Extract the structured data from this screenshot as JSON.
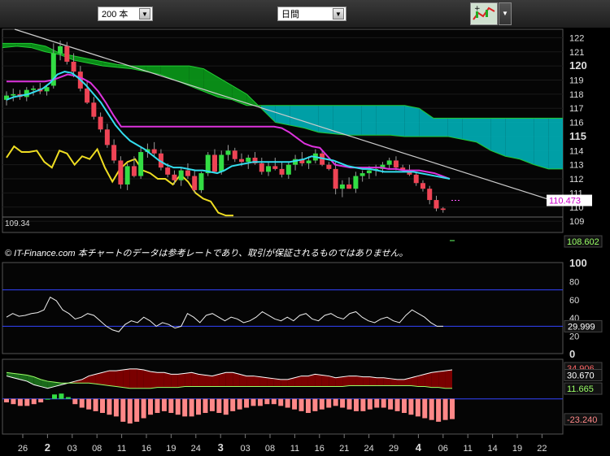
{
  "toolbar": {
    "period_select": "200 本",
    "interval_select": "日間",
    "tool_icon": "chart-tools-icon"
  },
  "colors": {
    "cloud_bull": "#0a9a1a",
    "cloud_bear": "#00b0b8",
    "up_candle": "#33dd44",
    "down_candle": "#ee4455",
    "tenkan": "#33ddee",
    "kijun": "#dd33dd",
    "chikou": "#eedd22",
    "trendline": "#cccccc"
  },
  "chart_data": [
    {
      "type": "candlestick",
      "name": "price-panel",
      "yticks": [
        "122",
        "121",
        "120",
        "119",
        "118",
        "117",
        "116",
        "115",
        "114",
        "113",
        "112",
        "111",
        "110",
        "109"
      ],
      "major_ticks": [
        "120",
        "115"
      ],
      "ylim": [
        108.2,
        122.6
      ],
      "copyright": "© IT-Finance.com  本チャートのデータは参考レートであり、取引が保証されるものではありません。",
      "price_labels": {
        "current": "110.473",
        "low": "108.602",
        "chikou_last": "109.34"
      },
      "candles": [
        [
          117.6,
          118.2,
          117.2,
          117.9
        ],
        [
          117.9,
          118.4,
          117.5,
          118.0
        ],
        [
          118.0,
          118.3,
          117.6,
          117.8
        ],
        [
          117.8,
          118.5,
          117.5,
          118.3
        ],
        [
          118.3,
          118.6,
          117.9,
          118.4
        ],
        [
          118.4,
          118.8,
          118.0,
          118.2
        ],
        [
          118.2,
          118.6,
          117.9,
          118.5
        ],
        [
          118.6,
          121.6,
          118.4,
          120.9
        ],
        [
          120.9,
          121.8,
          120.4,
          121.4
        ],
        [
          121.4,
          121.7,
          120.1,
          120.3
        ],
        [
          120.3,
          120.9,
          119.2,
          119.6
        ],
        [
          119.6,
          120.0,
          118.2,
          118.4
        ],
        [
          118.4,
          118.9,
          117.3,
          117.4
        ],
        [
          117.4,
          117.8,
          116.2,
          116.4
        ],
        [
          116.4,
          116.7,
          115.3,
          115.5
        ],
        [
          115.5,
          115.9,
          114.2,
          114.4
        ],
        [
          114.4,
          114.8,
          113.1,
          113.3
        ],
        [
          113.3,
          113.6,
          111.3,
          111.6
        ],
        [
          111.6,
          113.1,
          111.2,
          112.9
        ],
        [
          112.9,
          113.6,
          112.1,
          112.2
        ],
        [
          112.2,
          114.3,
          112.0,
          113.9
        ],
        [
          113.9,
          114.5,
          113.5,
          114.1
        ],
        [
          114.1,
          114.6,
          113.6,
          113.8
        ],
        [
          113.8,
          114.1,
          112.6,
          112.8
        ],
        [
          112.8,
          113.1,
          112.1,
          112.3
        ],
        [
          112.3,
          112.6,
          111.6,
          111.9
        ],
        [
          111.9,
          112.8,
          111.5,
          112.6
        ],
        [
          112.6,
          113.1,
          112.0,
          112.2
        ],
        [
          112.2,
          112.6,
          111.0,
          111.2
        ],
        [
          111.2,
          112.5,
          111.0,
          112.4
        ],
        [
          112.4,
          113.9,
          112.2,
          113.7
        ],
        [
          113.7,
          114.1,
          112.4,
          112.5
        ],
        [
          112.5,
          114.0,
          112.3,
          113.7
        ],
        [
          113.7,
          114.4,
          113.3,
          114.0
        ],
        [
          114.0,
          114.2,
          113.2,
          113.4
        ],
        [
          113.4,
          113.8,
          112.9,
          113.2
        ],
        [
          113.2,
          113.7,
          112.7,
          113.5
        ],
        [
          113.5,
          113.9,
          113.0,
          113.1
        ],
        [
          113.1,
          113.5,
          112.3,
          112.5
        ],
        [
          112.5,
          113.2,
          112.2,
          112.9
        ],
        [
          112.9,
          113.5,
          112.6,
          112.7
        ],
        [
          112.7,
          113.2,
          112.1,
          112.3
        ],
        [
          112.3,
          113.2,
          112.0,
          113.0
        ],
        [
          113.0,
          113.7,
          112.6,
          113.4
        ],
        [
          113.4,
          113.9,
          112.9,
          113.1
        ],
        [
          113.1,
          113.6,
          112.7,
          113.3
        ],
        [
          113.3,
          114.1,
          113.1,
          113.8
        ],
        [
          113.8,
          114.0,
          112.9,
          113.0
        ],
        [
          113.0,
          113.2,
          112.6,
          112.7
        ],
        [
          112.7,
          113.2,
          110.9,
          111.3
        ],
        [
          111.3,
          111.9,
          110.7,
          111.6
        ],
        [
          111.6,
          112.1,
          111.3,
          111.3
        ],
        [
          111.3,
          112.5,
          111.0,
          112.2
        ],
        [
          112.2,
          112.6,
          111.8,
          112.4
        ],
        [
          112.4,
          112.9,
          112.0,
          112.6
        ],
        [
          112.6,
          113.0,
          112.2,
          112.7
        ],
        [
          112.7,
          113.2,
          112.4,
          113.0
        ],
        [
          113.0,
          113.5,
          112.7,
          113.3
        ],
        [
          113.3,
          113.6,
          112.6,
          112.8
        ],
        [
          112.8,
          113.0,
          112.5,
          112.6
        ],
        [
          112.6,
          113.0,
          112.2,
          112.3
        ],
        [
          112.3,
          112.5,
          111.5,
          111.7
        ],
        [
          111.7,
          111.9,
          111.1,
          111.3
        ],
        [
          111.3,
          111.5,
          110.2,
          110.5
        ],
        [
          110.5,
          110.8,
          109.7,
          109.9
        ],
        [
          109.9,
          110.0,
          109.6,
          109.8
        ]
      ],
      "tenkan": [
        117.6,
        117.8,
        117.9,
        118.0,
        118.2,
        118.4,
        118.8,
        119.4,
        119.6,
        119.5,
        119.1,
        118.6,
        118.0,
        117.4,
        116.6,
        115.8,
        115.2,
        114.7,
        114.4,
        114.1,
        113.7,
        113.3,
        113.0,
        112.8,
        112.8,
        112.7,
        112.6,
        112.6,
        112.5,
        112.4,
        112.6,
        112.9,
        113.0,
        113.1,
        113.2,
        113.2,
        113.2,
        113.2,
        113.2,
        113.2,
        113.3,
        113.4,
        113.6,
        113.5,
        113.4,
        113.3,
        113.1,
        112.9,
        112.8,
        112.7,
        112.7,
        112.6,
        112.5,
        112.5,
        112.5,
        112.5,
        112.5,
        112.4,
        112.3,
        112.2,
        112.1,
        112.0
      ],
      "kijun": [
        118.9,
        118.9,
        118.9,
        118.9,
        118.9,
        118.9,
        119.0,
        119.2,
        119.4,
        119.3,
        119.1,
        118.8,
        118.2,
        117.4,
        116.5,
        115.7,
        115.7,
        115.7,
        115.7,
        115.7,
        115.7,
        115.7,
        115.7,
        115.7,
        115.7,
        115.7,
        115.7,
        115.7,
        115.7,
        115.7,
        115.7,
        115.7,
        115.7,
        115.7,
        115.7,
        115.7,
        115.6,
        115.3,
        114.9,
        114.5,
        114.3,
        114.2,
        113.6,
        113.0,
        112.9,
        112.8,
        112.8,
        112.8,
        112.8,
        112.8,
        112.7,
        112.7,
        112.6,
        112.6,
        112.6,
        112.5,
        112.4,
        112.2,
        112.0
      ],
      "chikou": [
        113.5,
        114.3,
        113.9,
        113.9,
        114.0,
        113.2,
        112.8,
        114.0,
        113.8,
        113.0,
        113.6,
        113.4,
        114.1,
        112.8,
        111.8,
        112.7,
        113.2,
        113.4,
        112.6,
        112.4,
        112.0,
        112.0,
        111.6,
        112.3,
        111.8,
        111.0,
        110.6,
        110.4,
        109.6,
        109.4,
        109.4
      ],
      "span_a": [
        121.3,
        121.4,
        121.3,
        121.0,
        120.8,
        120.4,
        120.2,
        120.0,
        119.9,
        119.8,
        119.6,
        119.4,
        119.0,
        118.6,
        118.2,
        117.8,
        117.6,
        117.2,
        117.2,
        117.2,
        117.2,
        117.2,
        117.2,
        117.2,
        117.2,
        117.2,
        117.2,
        117.2,
        117.2,
        117.0,
        116.3,
        116.3,
        116.3,
        116.3,
        116.3,
        116.3,
        116.3,
        116.3,
        116.3,
        116.3
      ],
      "span_b": [
        121.6,
        121.6,
        121.6,
        121.4,
        120.9,
        120.7,
        120.5,
        120.3,
        120.1,
        120.0,
        120.0,
        120.0,
        120.0,
        120.0,
        119.8,
        119.2,
        118.6,
        118.0,
        117.0,
        116.0,
        115.8,
        115.6,
        115.3,
        115.2,
        115.1,
        115.1,
        115.1,
        115.1,
        115.0,
        115.0,
        115.0,
        115.0,
        114.8,
        114.6,
        114.0,
        113.6,
        113.4,
        113.0,
        112.7,
        112.7
      ],
      "xticks": [
        "26",
        "2",
        "03",
        "08",
        "11",
        "16",
        "19",
        "24",
        "3",
        "03",
        "08",
        "11",
        "16",
        "21",
        "24",
        "29",
        "4",
        "06",
        "11",
        "14",
        "19",
        "22"
      ],
      "major_xticks": [
        "2",
        "3",
        "4"
      ]
    },
    {
      "type": "line",
      "name": "rsi-panel",
      "yticks": [
        "100",
        "80",
        "60",
        "40",
        "20",
        "0"
      ],
      "ylim": [
        0,
        100
      ],
      "levels": [
        70,
        30
      ],
      "current_label": "29.999",
      "values": [
        40,
        44,
        41,
        42,
        44,
        45,
        48,
        62,
        58,
        48,
        44,
        38,
        40,
        44,
        42,
        36,
        30,
        26,
        24,
        32,
        36,
        34,
        40,
        36,
        30,
        34,
        32,
        28,
        30,
        44,
        40,
        34,
        42,
        44,
        40,
        36,
        40,
        38,
        34,
        36,
        40,
        46,
        42,
        38,
        36,
        40,
        36,
        42,
        44,
        38,
        36,
        42,
        44,
        40,
        38,
        44,
        46,
        40,
        36,
        34,
        38,
        40,
        36,
        34,
        42,
        48,
        44,
        40,
        34,
        30,
        30
      ]
    },
    {
      "type": "area",
      "name": "macd-panel",
      "labels": [
        "34.906",
        "30.670",
        "11.665",
        "-23.240"
      ],
      "ylim": [
        -40,
        45
      ],
      "zero": 0,
      "line_a": [
        26,
        24,
        22,
        20,
        16,
        14,
        12,
        14,
        16,
        18,
        20,
        22,
        26,
        28,
        30,
        32,
        32,
        33,
        34,
        34,
        33,
        31,
        30,
        30,
        28,
        28,
        29,
        30,
        28,
        27,
        26,
        28,
        30,
        30,
        28,
        26,
        26,
        25,
        24,
        23,
        22,
        22,
        24,
        26,
        26,
        28,
        27,
        26,
        24,
        25,
        26,
        26,
        25,
        25,
        24,
        24,
        23,
        22,
        22,
        24,
        26,
        28,
        30,
        31,
        32,
        33
      ],
      "line_b": [
        30,
        29,
        28,
        27,
        25,
        22,
        20,
        19,
        18,
        18,
        18,
        18,
        18,
        17,
        16,
        15,
        14,
        13,
        12,
        12,
        12,
        12,
        13,
        13,
        13,
        13,
        14,
        14,
        14,
        14,
        14,
        14,
        14,
        14,
        14,
        14,
        14,
        14,
        14,
        14,
        14,
        14,
        14,
        14,
        14,
        14,
        14,
        14,
        14,
        14,
        15,
        15,
        15,
        15,
        15,
        15,
        15,
        15,
        15,
        15,
        14,
        14,
        13,
        13,
        12,
        12
      ],
      "hist": [
        -4,
        -6,
        -8,
        -8,
        -6,
        -4,
        0,
        5,
        6,
        2,
        -6,
        -10,
        -12,
        -14,
        -16,
        -18,
        -20,
        -26,
        -28,
        -26,
        -22,
        -18,
        -16,
        -14,
        -16,
        -18,
        -20,
        -20,
        -18,
        -16,
        -14,
        -16,
        -18,
        -14,
        -12,
        -10,
        -8,
        -8,
        -6,
        -6,
        -8,
        -10,
        -12,
        -14,
        -16,
        -14,
        -12,
        -10,
        -8,
        -10,
        -12,
        -14,
        -14,
        -12,
        -10,
        -10,
        -12,
        -14,
        -16,
        -18,
        -20,
        -22,
        -24,
        -26,
        -24,
        -23
      ]
    }
  ]
}
